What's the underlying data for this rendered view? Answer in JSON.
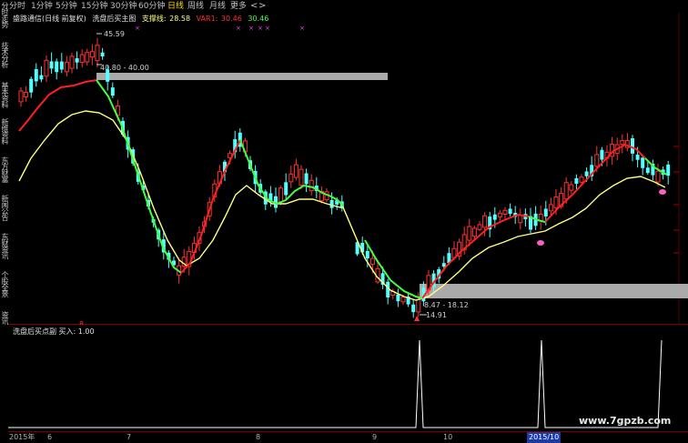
{
  "sidebar": {
    "tabs": [
      {
        "label": "分时走势"
      },
      {
        "label": "技术分析"
      },
      {
        "label": "基本资料"
      },
      {
        "label": "新维资料"
      },
      {
        "label": "东方财富"
      },
      {
        "label": "新闻公告"
      },
      {
        "label": "东财资讯"
      },
      {
        "label": "个股全景"
      },
      {
        "label": "资讯"
      }
    ]
  },
  "period_bar": {
    "tabs": [
      {
        "label": "分时",
        "active": false
      },
      {
        "label": "1分钟",
        "active": false
      },
      {
        "label": "5分钟",
        "active": false
      },
      {
        "label": "15分钟",
        "active": false
      },
      {
        "label": "30分钟",
        "active": false
      },
      {
        "label": "60分钟",
        "active": false
      },
      {
        "label": "日线",
        "active": true
      },
      {
        "label": "周线",
        "active": false
      },
      {
        "label": "月线",
        "active": false
      },
      {
        "label": "更多",
        "active": false
      }
    ],
    "prev_arrow": "<",
    "next_arrow": ">"
  },
  "indicator": {
    "stock_name": "盛路通信(日线 前复权)",
    "formula_name": "洗盘后买主图",
    "support_label": "支撑线:",
    "support_value": "28.58",
    "var1_label": "VAR1:",
    "var1_value": "30.46",
    "third_value": "30.46"
  },
  "price_labels": {
    "high": "45.59",
    "range_top": "40.80 - 40.00",
    "range_bottom": "8.47 - 18.12",
    "low": "14.91"
  },
  "sub_chart": {
    "title": "洗盘后买点副",
    "buy_label": "买入: 1.00"
  },
  "time_axis": {
    "labels": [
      {
        "text": "2015年",
        "highlight": false
      },
      {
        "text": "6",
        "highlight": false
      },
      {
        "text": "7",
        "highlight": false
      },
      {
        "text": "8",
        "highlight": false
      },
      {
        "text": "9",
        "highlight": false
      },
      {
        "text": "10",
        "highlight": false
      },
      {
        "text": "2015/10",
        "highlight": true
      }
    ]
  },
  "watermark": "www.7gpzb.com",
  "colors": {
    "up": "#ff3232",
    "down": "#54ffff",
    "ma_red": "#ff2020",
    "ma_green": "#40ff40",
    "ma_yellow": "#ffff80",
    "band": "#aaaaaa",
    "signal": "#ffffff"
  }
}
